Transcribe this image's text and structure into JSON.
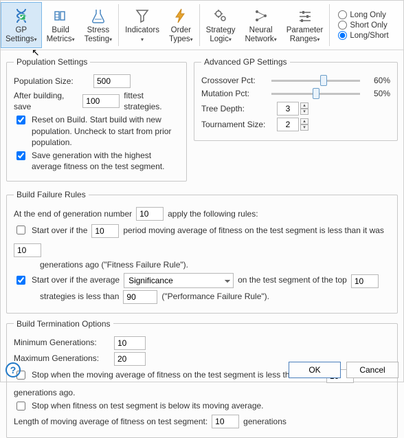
{
  "toolbar": {
    "buttons": [
      {
        "key": "gp-settings",
        "label": "GP\nSettings",
        "drop": true
      },
      {
        "key": "build-metrics",
        "label": "Build\nMetrics",
        "drop": true
      },
      {
        "key": "stress-testing",
        "label": "Stress\nTesting",
        "drop": true
      },
      {
        "key": "indicators",
        "label": "Indicators",
        "drop": true
      },
      {
        "key": "order-types",
        "label": "Order\nTypes",
        "drop": true
      },
      {
        "key": "strategy-logic",
        "label": "Strategy\nLogic",
        "drop": true
      },
      {
        "key": "neural-network",
        "label": "Neural\nNetwork",
        "drop": true
      },
      {
        "key": "param-ranges",
        "label": "Parameter\nRanges",
        "drop": true
      }
    ],
    "active": "gp-settings",
    "radios": {
      "long_only": "Long Only",
      "short_only": "Short Only",
      "long_short": "Long/Short",
      "selected": "long_short"
    }
  },
  "population": {
    "legend": "Population Settings",
    "size_label": "Population Size:",
    "size_value": "500",
    "after_label_a": "After building, save",
    "after_value": "100",
    "after_label_b": "fittest strategies.",
    "reset_checked": true,
    "reset_text": "Reset on Build. Start build with new population. Uncheck to start from prior population.",
    "savegen_checked": true,
    "savegen_text": "Save generation with the highest average fitness on the test segment."
  },
  "advanced": {
    "legend": "Advanced GP Settings",
    "crossover_label": "Crossover Pct:",
    "crossover_value": 60,
    "crossover_text": "60%",
    "mutation_label": "Mutation Pct:",
    "mutation_value": 50,
    "mutation_text": "50%",
    "treedepth_label": "Tree Depth:",
    "treedepth_value": "3",
    "tourn_label": "Tournament Size:",
    "tourn_value": "2"
  },
  "failure": {
    "legend": "Build Failure Rules",
    "l1a": "At the end of generation number",
    "l1_value": "10",
    "l1b": "apply the following rules:",
    "r1_checked": false,
    "r1a": "Start over if the",
    "r1_value": "10",
    "r1b": "period moving average of fitness on the test segment is less than it was",
    "r1c_value": "10",
    "r1d": "generations ago (\"Fitness Failure Rule\").",
    "r2_checked": true,
    "r2a": "Start over if the average",
    "r2_sel": "Significance",
    "r2_options": [
      "Significance"
    ],
    "r2b": "on the test segment of the top",
    "r2c_value": "10",
    "r2d": "strategies  is less than",
    "r2e_value": "90",
    "r2f": "(\"Performance Failure Rule\")."
  },
  "termination": {
    "legend": "Build Termination Options",
    "min_label": "Minimum Generations:",
    "min_value": "10",
    "max_label": "Maximum Generations:",
    "max_value": "20",
    "s1_checked": false,
    "s1a": "Stop when the moving average of fitness on the test segment is less than it was",
    "s1_value": "10",
    "s1b": "generations ago.",
    "s2_checked": false,
    "s2a": "Stop when fitness on test segment is below its moving average.",
    "len_a": "Length of moving average of fitness on test segment:",
    "len_value": "10",
    "len_b": "generations"
  },
  "footer": {
    "ok": "OK",
    "cancel": "Cancel"
  },
  "colors": {
    "accent": "#2f78c3",
    "toolbar_active_bg": "#d6e8f7"
  }
}
